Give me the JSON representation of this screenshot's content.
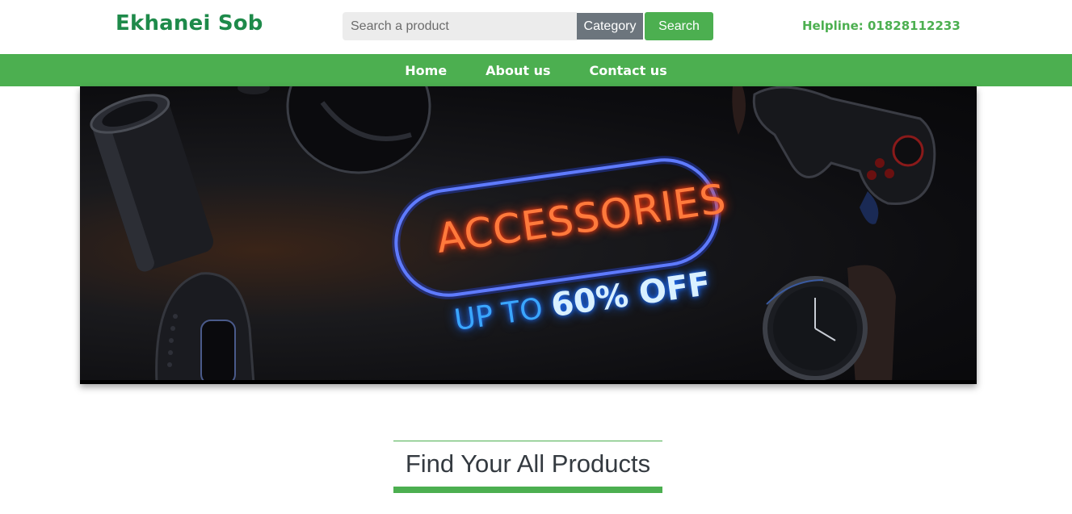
{
  "header": {
    "logo": "Ekhanei Sob",
    "search": {
      "placeholder": "Search a product",
      "value": "",
      "category_label": "Category",
      "button_label": "Search"
    },
    "helpline": "Helpline: 01828112233"
  },
  "nav": {
    "items": [
      {
        "label": "Home"
      },
      {
        "label": "About us"
      },
      {
        "label": "Contact us"
      }
    ]
  },
  "banner": {
    "headline": "ACCESSORIES",
    "offer_prefix": "UP TO",
    "offer_value": "60% OFF"
  },
  "section": {
    "title": "Find Your All Products"
  },
  "colors": {
    "brand_green": "#4caf50",
    "logo_green": "#1e8a4a",
    "category_gray": "#6c757d"
  }
}
